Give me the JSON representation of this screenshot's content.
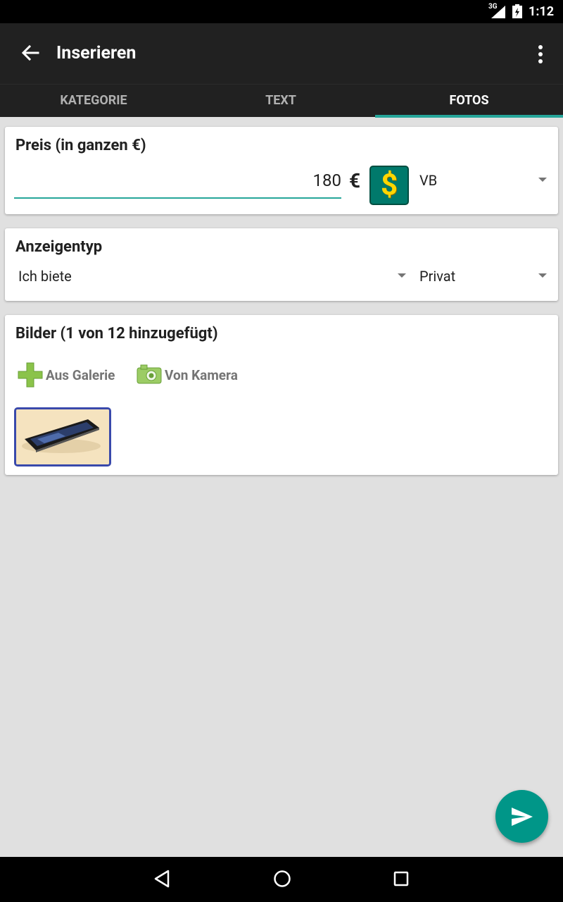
{
  "status": {
    "network": "3G",
    "time": "1:12"
  },
  "appbar": {
    "title": "Inserieren"
  },
  "tabs": [
    {
      "label": "KATEGORIE",
      "active": false
    },
    {
      "label": "TEXT",
      "active": false
    },
    {
      "label": "FOTOS",
      "active": true
    }
  ],
  "price": {
    "title": "Preis (in ganzen €)",
    "value": "180",
    "currency": "€",
    "price_type": "VB"
  },
  "ad_type": {
    "title": "Anzeigentyp",
    "offer_type": "Ich biete",
    "seller_type": "Privat"
  },
  "images": {
    "title": "Bilder (1 von 12 hinzugefügt)",
    "gallery_label": "Aus Galerie",
    "camera_label": "Von Kamera"
  },
  "colors": {
    "accent": "#26a69a",
    "fab": "#009688",
    "toolbar": "#212121"
  }
}
